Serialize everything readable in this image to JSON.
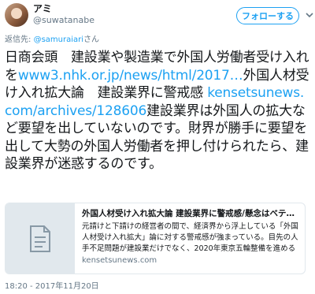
{
  "user": {
    "display_name": "アミ",
    "handle": "@suwatanabe"
  },
  "follow_button": {
    "label": "フォローする"
  },
  "reply_to": {
    "prefix": "返信先: ",
    "mention": "@samuraiari",
    "suffix": "さん"
  },
  "tweet": {
    "text_1": "日商会頭　建設業や製造業で外国人労働者受け入れを",
    "link_1": "www3.nhk.or.jp/news/html/2017…",
    "text_2": "外国人材受け入れ拡大論　建設業界に警戒感",
    "link_2": "kensetsunews.com/archives/128606",
    "text_3": "建設業界は外国人の拡大など要望を出していないのです。財界が勝手に要望を出して大勢の外国人労働者を押し付けられたら、建設業界が迷惑するのです。"
  },
  "card": {
    "title": "外国人材受け入れ拡大論 建設業界に警戒感/懸念はベテランの…",
    "description": "元請けと下請けの経営者の間で、経済界から浮上している「外国人材受け入れ拡大」論に対する警戒感が強まっている。目先の人手不足問題が建設業だけでなく、2020年東京五輪整備を進める建設業…",
    "domain": "kensetsunews.com"
  },
  "timestamp": "18:20 - 2017年11月20日",
  "colors": {
    "link": "#1da1f2",
    "secondary_text": "#657786",
    "border": "#e1e8ed"
  },
  "icons": {
    "caret": "chevron-down-icon",
    "card_thumbnail": "document-icon"
  }
}
